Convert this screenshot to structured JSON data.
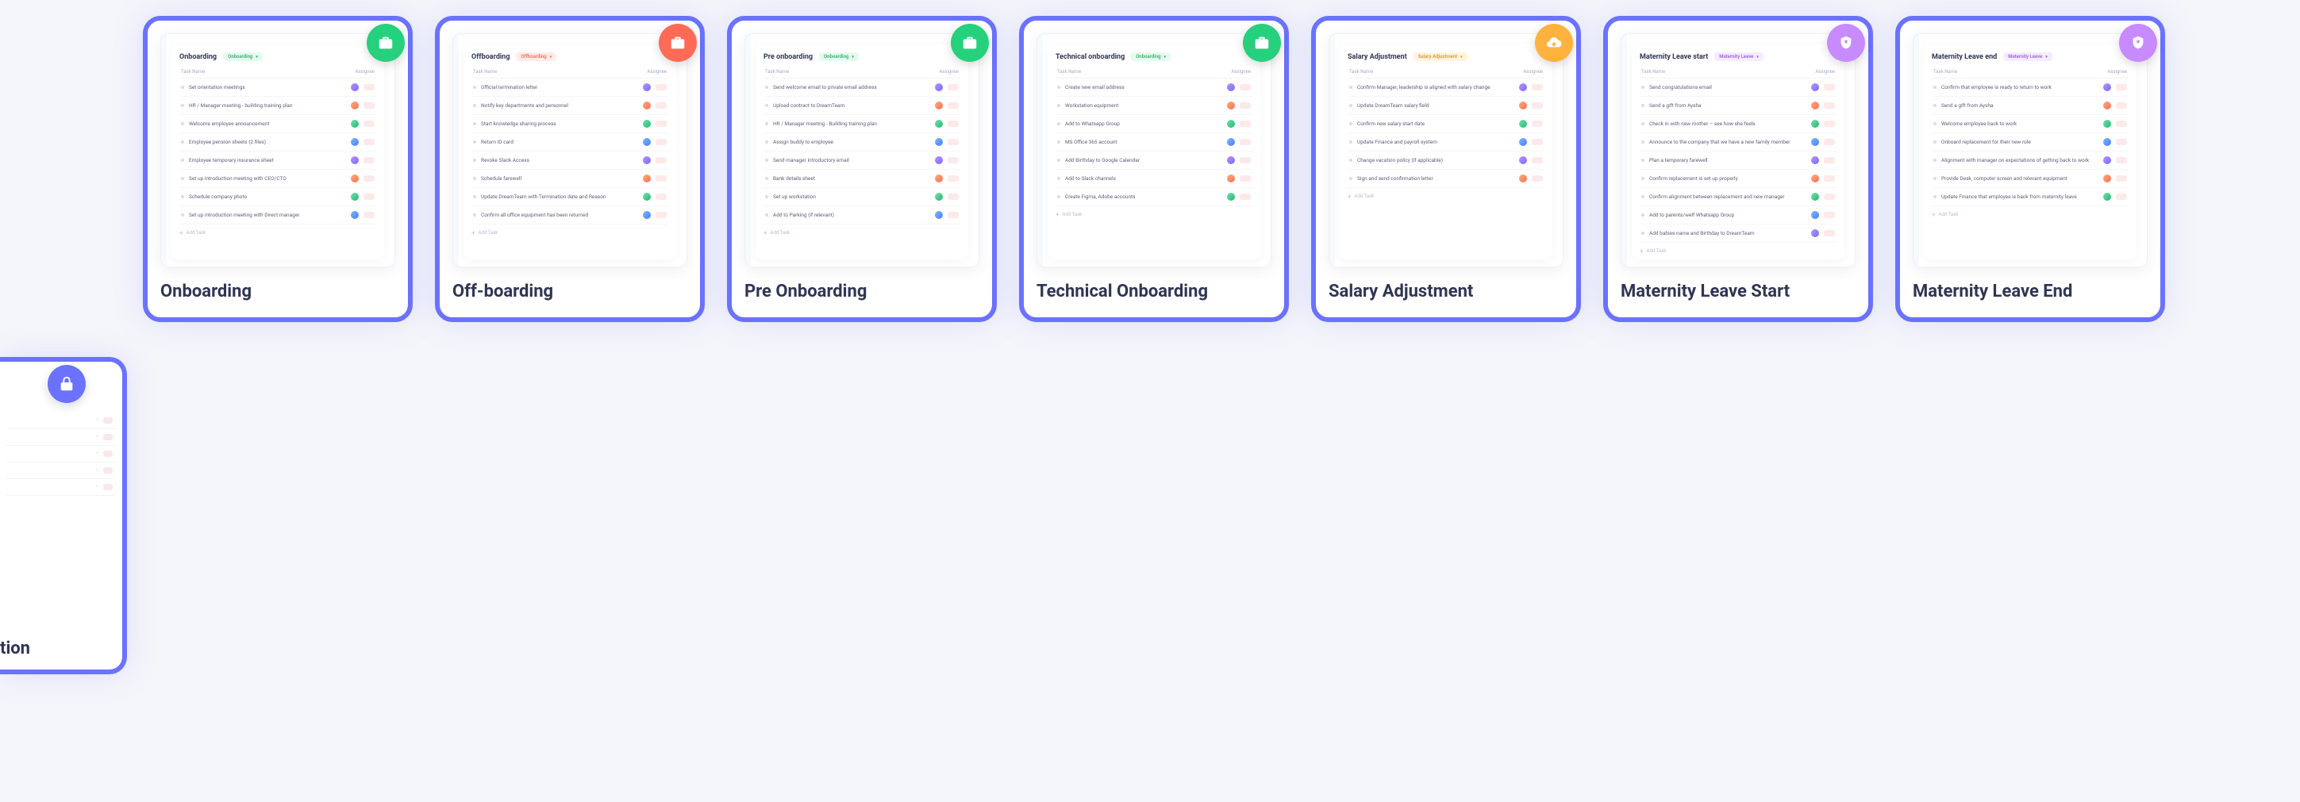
{
  "columns": {
    "task": "Task Name",
    "assignee": "Assignee"
  },
  "add_task_label": "Add Task",
  "partial_card": {
    "title_fragment": "tion"
  },
  "cards": [
    {
      "id": "onboarding",
      "title": "Onboarding",
      "preview_title": "Onboarding",
      "tag_text": "Onboarding",
      "tag_class": "onboard",
      "badge": "green",
      "badge_icon": "briefcase-x",
      "tasks": [
        "Set orientation meetings",
        "HR / Manager meeting - building training plan",
        "Welcome employee announcement",
        "Employee pension sheets (2 files)",
        "Employee temporary insurance sheet",
        "Set up introduction meeting with CEO/CTO",
        "Schedule company photo",
        "Set up introduction meeting with Direct manager"
      ]
    },
    {
      "id": "offboarding",
      "title": "Off-boarding",
      "preview_title": "Offboarding",
      "tag_text": "Offboarding",
      "tag_class": "offboard",
      "badge": "red",
      "badge_icon": "briefcase-check",
      "tasks": [
        "Official termination letter",
        "Notify key departments and personnel",
        "Start knowledge sharing process",
        "Return ID card",
        "Revoke Slack Access",
        "Schedule farewell",
        "Update DreamTeam with Termination date and Reason",
        "Confirm all office equipment has been returned"
      ]
    },
    {
      "id": "preonboarding",
      "title": "Pre Onboarding",
      "preview_title": "Pre onboarding",
      "tag_text": "Onboarding",
      "tag_class": "onboard",
      "badge": "green",
      "badge_icon": "briefcase-x",
      "tasks": [
        "Send welcome email to private email address",
        "Upload contract to DreamTeam",
        "HR / Manager meeting - Building training plan",
        "Assign buddy to employee",
        "Send manager introductory email",
        "Bank details sheet",
        "Set up workstation",
        "Add to Parking (if relevant)"
      ]
    },
    {
      "id": "technical",
      "title": "Technical Onboarding",
      "preview_title": "Technical onboarding",
      "tag_text": "Onboarding",
      "tag_class": "onboard",
      "badge": "green",
      "badge_icon": "briefcase-x",
      "tasks": [
        "Create new email address",
        "Workstation equipment",
        "Add to Whatsapp Group",
        "MS Office 365 account",
        "Add Birthday to Google Calendar",
        "Add to Slack channels",
        "Create Figma, Adobe accounts"
      ]
    },
    {
      "id": "salary",
      "title": "Salary Adjustment",
      "preview_title": "Salary Adjustment",
      "tag_text": "Salary Adjustment",
      "tag_class": "salary",
      "badge": "orange",
      "badge_icon": "cloud-plus",
      "tasks": [
        "Confirm Manager, leadership is aligned with salary change",
        "Update DreamTeam salary field",
        "Confirm new salary start date",
        "Update Finance and payroll system",
        "Change vacation policy (if applicable)",
        "Sign and send confirmation letter"
      ]
    },
    {
      "id": "matstart",
      "title": "Maternity Leave Start",
      "preview_title": "Maternity Leave start",
      "tag_text": "Maternity Leave",
      "tag_class": "maternity",
      "badge": "purple",
      "badge_icon": "heart-shield",
      "tasks": [
        "Send congratulations email",
        "Send a gift from Aysha",
        "Check in with new mother – see how she feels",
        "Announce to the company that we have a new family member",
        "Plan a temporary farewell",
        "Confirm replacement is set up properly",
        "Confirm alignment between replacement and new manager",
        "Add to parents/welf Whatsapp Group",
        "Add babies name and Birthday to DreamTeam"
      ]
    },
    {
      "id": "matend",
      "title": "Maternity Leave End",
      "preview_title": "Maternity Leave end",
      "tag_text": "Maternity Leave",
      "tag_class": "maternity",
      "badge": "purple",
      "badge_icon": "heart-shield",
      "tasks": [
        "Confirm that employee is ready to return to work",
        "Send a gift from Aysha",
        "Welcome employee back to work",
        "Onboard replacement for their new role",
        "Alignment with manager on expectations of getting back to work",
        "Provide Desk, computer screen and relevant equipment",
        "Update Finance that employee is back from maternity leave"
      ]
    }
  ]
}
